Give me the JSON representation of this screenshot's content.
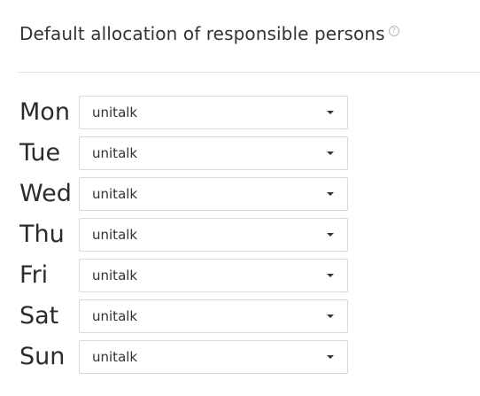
{
  "header": {
    "title": "Default allocation of responsible persons",
    "help_icon": "question-circle-icon",
    "help_glyph": "?"
  },
  "days": [
    {
      "label": "Mon",
      "value": "unitalk"
    },
    {
      "label": "Tue",
      "value": "unitalk"
    },
    {
      "label": "Wed",
      "value": "unitalk"
    },
    {
      "label": "Thu",
      "value": "unitalk"
    },
    {
      "label": "Fri",
      "value": "unitalk"
    },
    {
      "label": "Sat",
      "value": "unitalk"
    },
    {
      "label": "Sun",
      "value": "unitalk"
    }
  ]
}
